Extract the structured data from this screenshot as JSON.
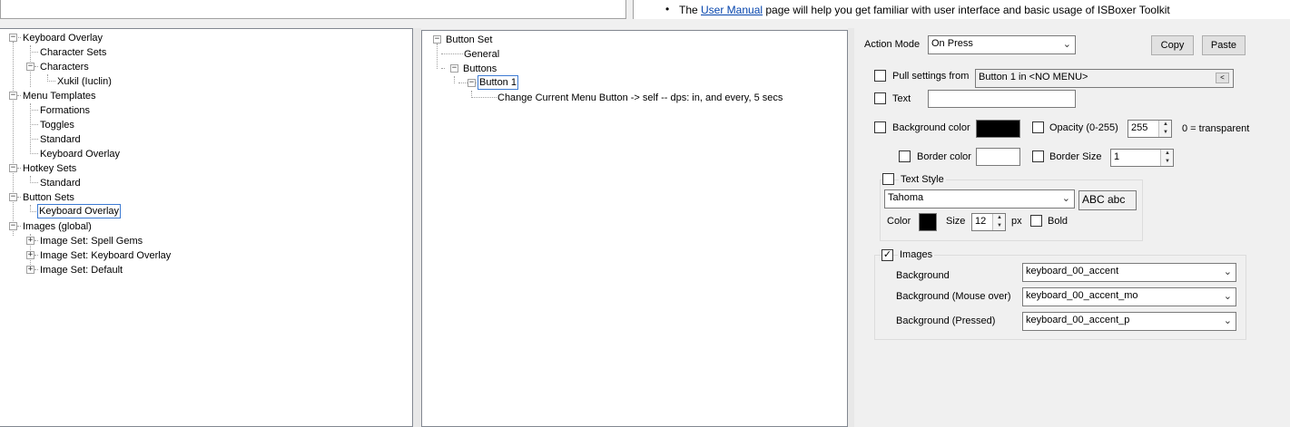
{
  "header": {
    "bullet": "•",
    "help_prefix": "The ",
    "help_link": "User Manual",
    "help_suffix": " page will help you get familiar with user interface and basic usage of ISBoxer Toolkit"
  },
  "left_tree": {
    "keyboard_overlay": "Keyboard Overlay",
    "character_sets": "Character Sets",
    "characters": "Characters",
    "xukil": "Xukil (Iuclin)",
    "menu_templates": "Menu Templates",
    "formations": "Formations",
    "toggles": "Toggles",
    "standard": "Standard",
    "mt_keyboard_overlay": "Keyboard Overlay",
    "hotkey_sets": "Hotkey Sets",
    "hs_standard": "Standard",
    "button_sets": "Button Sets",
    "bs_keyboard_overlay": "Keyboard Overlay",
    "images_global": "Images (global)",
    "img_spell_gems": "Image Set: Spell Gems",
    "img_keyboard_overlay": "Image Set: Keyboard Overlay",
    "img_default": "Image Set: Default"
  },
  "mid_tree": {
    "button_set": "Button Set",
    "general": "General",
    "buttons": "Buttons",
    "button1": "Button 1",
    "action": "Change Current Menu Button -> self -- dps: in, and every, 5 secs"
  },
  "props": {
    "action_mode_label": "Action Mode",
    "action_mode_value": "On Press",
    "copy": "Copy",
    "paste": "Paste",
    "pull_settings_label": "Pull settings from",
    "pull_settings_value": "Button 1 in <NO MENU>",
    "pull_settings_btn": "<",
    "text_label": "Text",
    "text_value": "",
    "bg_color_label": "Background color",
    "opacity_label": "Opacity (0-255)",
    "opacity_value": "255",
    "transparent_note": "0 = transparent",
    "border_color_label": "Border color",
    "border_size_label": "Border Size",
    "border_size_value": "1",
    "text_style_label": "Text Style",
    "font_value": "Tahoma",
    "font_preview": "ABC abc",
    "color_label": "Color",
    "size_label": "Size",
    "size_value": "12",
    "px_label": "px",
    "bold_label": "Bold",
    "images_label": "Images",
    "images_checked": "✓",
    "bg_label": "Background",
    "bg_value": "keyboard_00_accent",
    "bg_mo_label": "Background (Mouse over)",
    "bg_mo_value": "keyboard_00_accent_mo",
    "bg_p_label": "Background (Pressed)",
    "bg_p_value": "keyboard_00_accent_p"
  },
  "colors": {
    "background_swatch": "#000000",
    "border_swatch": "#ffffff",
    "text_color_swatch": "#000000",
    "link": "#0645ad",
    "selection_border": "#3d7bd3"
  },
  "icons": {
    "expander_open": "⊟",
    "expander_closed": "⊞",
    "dropdown": "chevron-down-icon",
    "spin": "spin-arrows-icon"
  }
}
